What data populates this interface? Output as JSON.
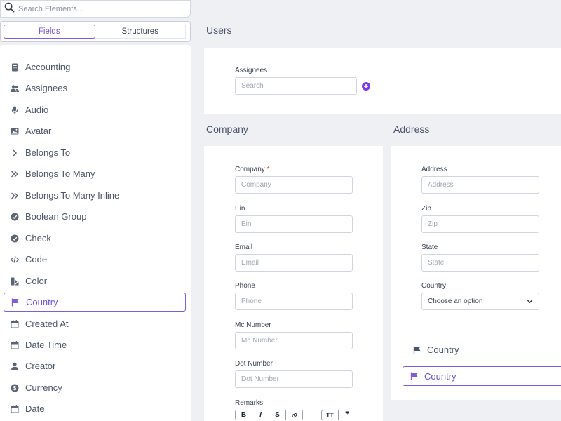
{
  "sidebar": {
    "search_placeholder": "Search Elements...",
    "tabs": {
      "fields": "Fields",
      "structures": "Structures"
    },
    "items": [
      {
        "label": "Accounting",
        "icon": "calculator-icon"
      },
      {
        "label": "Assignees",
        "icon": "users-icon"
      },
      {
        "label": "Audio",
        "icon": "microphone-icon"
      },
      {
        "label": "Avatar",
        "icon": "image-icon"
      },
      {
        "label": "Belongs To",
        "icon": "chevron-right-icon"
      },
      {
        "label": "Belongs To Many",
        "icon": "double-chevron-right-icon"
      },
      {
        "label": "Belongs To Many Inline",
        "icon": "double-chevron-right-icon"
      },
      {
        "label": "Boolean Group",
        "icon": "check-circle-icon"
      },
      {
        "label": "Check",
        "icon": "check-circle-icon"
      },
      {
        "label": "Code",
        "icon": "code-icon"
      },
      {
        "label": "Color",
        "icon": "palette-icon"
      },
      {
        "label": "Country",
        "icon": "flag-icon",
        "selected": true
      },
      {
        "label": "Created At",
        "icon": "calendar-icon"
      },
      {
        "label": "Date Time",
        "icon": "calendar-icon"
      },
      {
        "label": "Creator",
        "icon": "user-icon"
      },
      {
        "label": "Currency",
        "icon": "dollar-circle-icon"
      },
      {
        "label": "Date",
        "icon": "calendar-icon"
      }
    ]
  },
  "users": {
    "title": "Users",
    "assignees_label": "Assignees",
    "assignees_placeholder": "Search"
  },
  "company": {
    "title": "Company",
    "fields": [
      {
        "label": "Company",
        "required": "*",
        "placeholder": "Company"
      },
      {
        "label": "Ein",
        "placeholder": "Ein"
      },
      {
        "label": "Email",
        "placeholder": "Email"
      },
      {
        "label": "Phone",
        "placeholder": "Phone"
      },
      {
        "label": "Mc Number",
        "placeholder": "Mc Number"
      },
      {
        "label": "Dot Number",
        "placeholder": "Dot Number"
      }
    ],
    "remarks_label": "Remarks",
    "toolbar": {
      "bold": "B",
      "italic": "I",
      "strike": "S",
      "link": "link-icon",
      "heading": "TT",
      "quote": "❞"
    }
  },
  "address": {
    "title": "Address",
    "fields": [
      {
        "label": "Address",
        "placeholder": "Address"
      },
      {
        "label": "Zip",
        "placeholder": "Zip"
      },
      {
        "label": "State",
        "placeholder": "State"
      }
    ],
    "country_label": "Country",
    "country_select": "Choose an option",
    "drag_label": "Country",
    "drop_label": "Country"
  },
  "colors": {
    "accent": "#7c5ce0",
    "background": "#eef0f4"
  }
}
